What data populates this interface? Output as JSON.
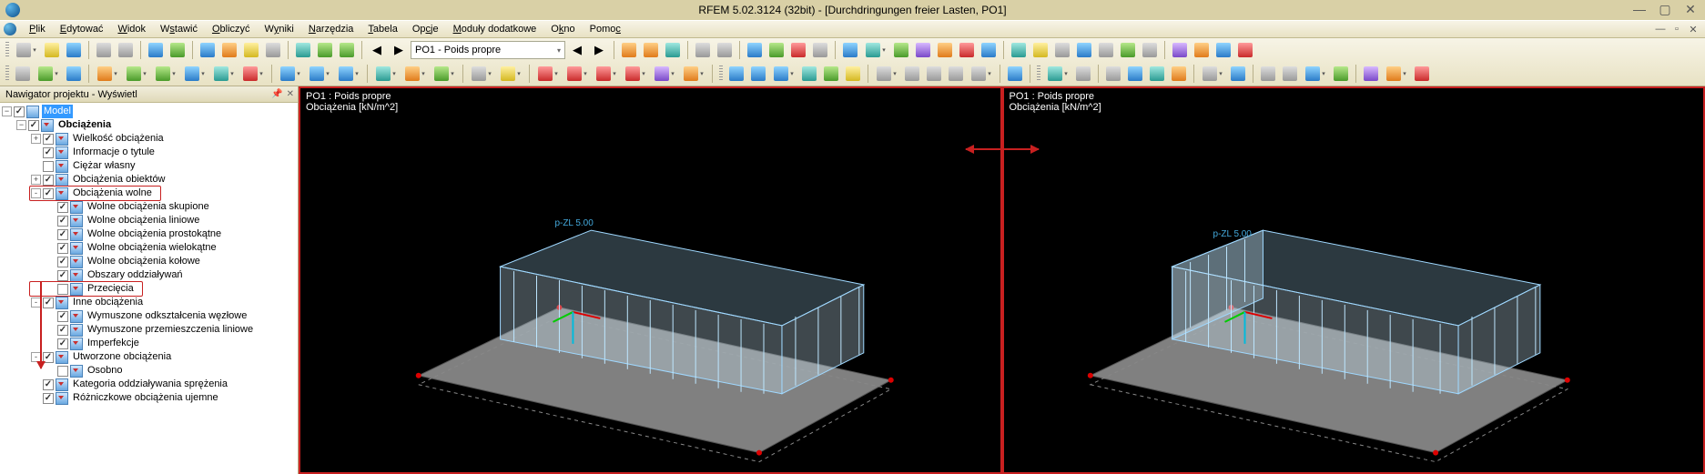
{
  "titlebar": {
    "title": "RFEM 5.02.3124 (32bit) - [Durchdringungen freier Lasten, PO1]"
  },
  "menus": [
    "Plik",
    "Edytować",
    "Widok",
    "Wstawić",
    "Obliczyć",
    "Wyniki",
    "Narzędzia",
    "Tabela",
    "Opcje",
    "Moduły dodatkowe",
    "Okno",
    "Pomoc"
  ],
  "combo_loadcase": "PO1 - Poids propre",
  "navigator": {
    "title": "Nawigator projektu - Wyświetl",
    "root": "Model",
    "groups": [
      {
        "label": "Obciążenia",
        "bold": true,
        "children": [
          {
            "label": "Wielkość obciążenia",
            "expand": "+"
          },
          {
            "label": "Informacje o tytule"
          },
          {
            "label": "Ciężar własny",
            "checked": false
          },
          {
            "label": "Obciążenia obiektów",
            "expand": "+"
          },
          {
            "label": "Obciążenia wolne",
            "expand": "-",
            "boxed": true,
            "children": [
              {
                "label": "Wolne obciążenia skupione"
              },
              {
                "label": "Wolne obciążenia liniowe"
              },
              {
                "label": "Wolne obciążenia prostokątne"
              },
              {
                "label": "Wolne obciążenia wielokątne"
              },
              {
                "label": "Wolne obciążenia kołowe"
              },
              {
                "label": "Obszary oddziaływań"
              },
              {
                "label": "Przecięcia",
                "checked": false,
                "boxed": true
              }
            ]
          },
          {
            "label": "Inne obciążenia",
            "expand": "-",
            "children": [
              {
                "label": "Wymuszone odkształcenia węzłowe"
              },
              {
                "label": "Wymuszone przemieszczenia liniowe"
              },
              {
                "label": "Imperfekcje"
              }
            ]
          },
          {
            "label": "Utworzone obciążenia",
            "expand": "-",
            "children": [
              {
                "label": "Osobno",
                "checked": false
              }
            ]
          },
          {
            "label": "Kategoria oddziaływania sprężenia"
          },
          {
            "label": "Różniczkowe obciążenia ujemne"
          }
        ]
      }
    ]
  },
  "viewport": {
    "title_line1": "PO1 : Poids propre",
    "title_line2": "Obciążenia [kN/m^2]",
    "load_label": "p-ZL 5.00"
  }
}
